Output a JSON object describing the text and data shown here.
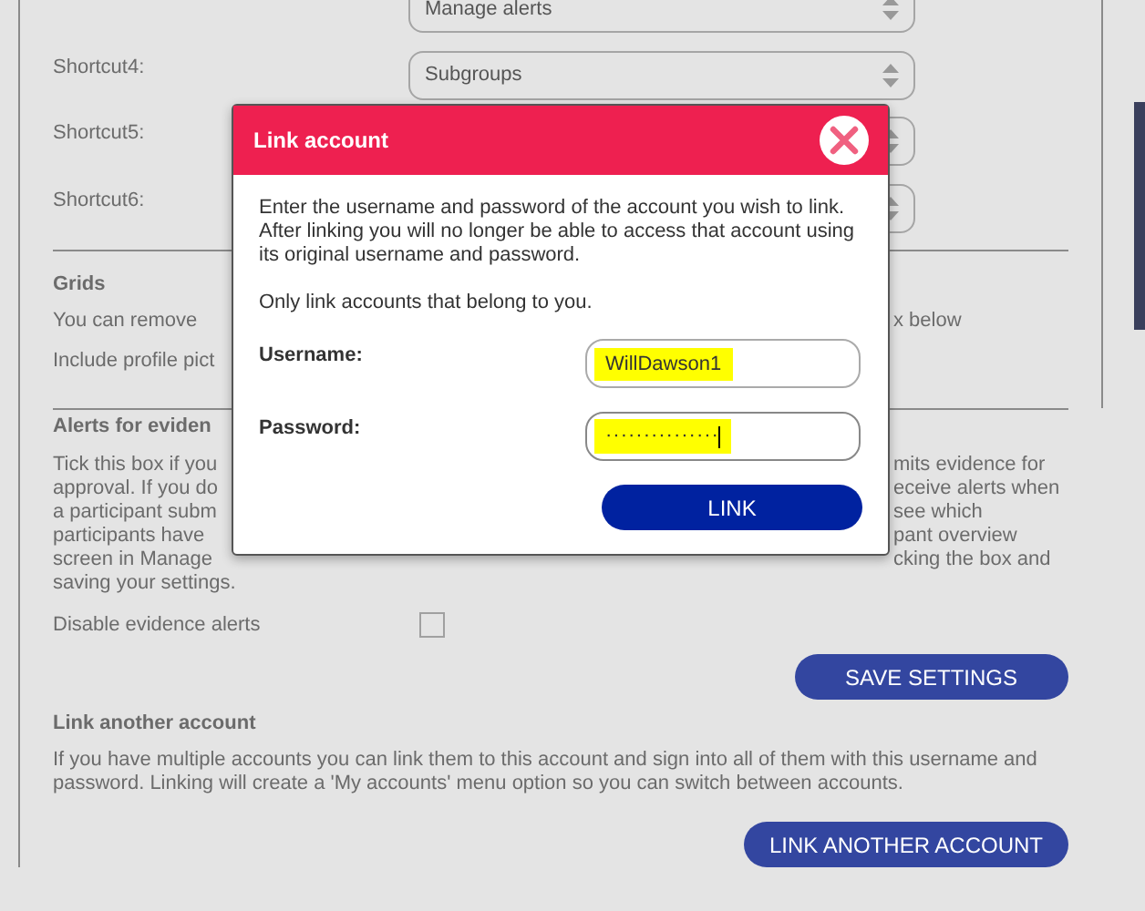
{
  "shortcut_rows": [
    {
      "value": "Manage alerts"
    },
    {
      "label": "Shortcut4:",
      "value": "Subgroups"
    },
    {
      "label": "Shortcut5:"
    },
    {
      "label": "Shortcut6:"
    }
  ],
  "grids": {
    "heading": "Grids",
    "lines": [
      {
        "left": "You can remove",
        "right": "x below"
      },
      {
        "left": "Include profile pict"
      }
    ]
  },
  "evidence_alerts": {
    "heading": "Alerts for eviden",
    "lines": [
      {
        "left": "Tick this box if you",
        "right": "mits evidence for"
      },
      {
        "left": "approval. If you do",
        "right": "eceive alerts when"
      },
      {
        "left": "a participant subm",
        "right": "see which"
      },
      {
        "left": "participants have",
        "right": "pant overview"
      },
      {
        "left": "screen in Manage",
        "right": "cking the box and"
      },
      {
        "left": "saving your settings."
      }
    ],
    "checkbox": {
      "label": "Disable evidence alerts",
      "checked": false
    },
    "button": "SAVE SETTINGS"
  },
  "link_another": {
    "heading": "Link another account",
    "text": "If you have multiple accounts you can link them to this account and sign into all of them with this username and password. Linking will create a 'My accounts' menu option so you can switch between accounts.",
    "button": "LINK ANOTHER ACCOUNT"
  },
  "modal": {
    "title": "Link account",
    "paragraphs": [
      "Enter the username and password of the account you wish to link. After linking you will no longer be able to access that account using its original username and password.",
      "Only link accounts that belong to you."
    ],
    "fields": [
      {
        "kind": "text",
        "label": "Username:",
        "value": "WillDawson1",
        "highlighted": true,
        "focused": false
      },
      {
        "kind": "password",
        "label": "Password:",
        "value": "···············",
        "highlighted": true,
        "focused": true
      }
    ],
    "button": "LINK"
  }
}
